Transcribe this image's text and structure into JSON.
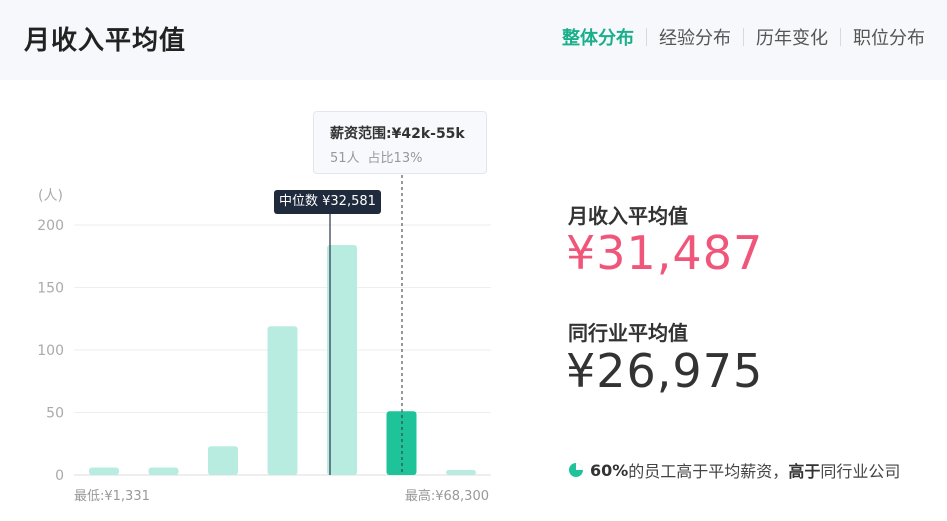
{
  "header": {
    "title": "月收入平均值",
    "tabs": [
      {
        "label": "整体分布",
        "active": true
      },
      {
        "label": "经验分布",
        "active": false
      },
      {
        "label": "历年变化",
        "active": false
      },
      {
        "label": "职位分布",
        "active": false
      }
    ]
  },
  "chart_data": {
    "type": "bar",
    "unit_label": "(人)",
    "yticks": [
      0,
      50,
      100,
      150,
      200
    ],
    "ylim": [
      0,
      200
    ],
    "values": [
      6,
      6,
      23,
      119,
      184,
      51,
      4
    ],
    "highlight_index": 5,
    "min_label": "最低:¥1,331",
    "max_label": "最高:¥68,300",
    "median_label": "中位数 ¥32,581",
    "tooltip": {
      "title": "薪资范围:¥42k-55k",
      "count": "51人",
      "share": "占比13%"
    },
    "colors": {
      "bar": "#b8ece1",
      "highlight": "#1fc39a"
    }
  },
  "stats": {
    "avg_label": "月收入平均值",
    "avg_value": "¥31,487",
    "industry_label": "同行业平均值",
    "industry_value": "¥26,975"
  },
  "footnote": {
    "pct": "60%",
    "text1": "的员工高于平均薪资，",
    "bold": "高于",
    "text2": "同行业公司"
  },
  "colors": {
    "accent": "#1aaf8b",
    "pink": "#f0557a"
  }
}
